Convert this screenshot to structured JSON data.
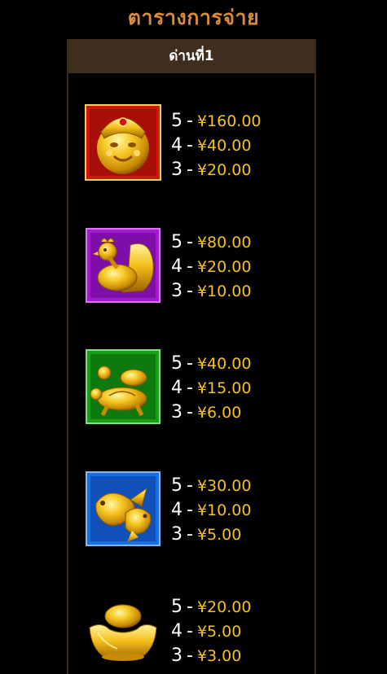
{
  "title": "ตารางการจ่าย",
  "level": "ด่านที่1",
  "colors": {
    "title": "#d98a3a",
    "header_bg": "#3f2d1e",
    "amount": "#f3c21d",
    "count": "#ffffff"
  },
  "symbols": [
    {
      "icon": "god-of-wealth-icon",
      "pays": [
        {
          "count": "5",
          "dash": "-",
          "amount": "¥160.00"
        },
        {
          "count": "4",
          "dash": "-",
          "amount": "¥40.00"
        },
        {
          "count": "3",
          "dash": "-",
          "amount": "¥20.00"
        }
      ]
    },
    {
      "icon": "rooster-icon",
      "pays": [
        {
          "count": "5",
          "dash": "-",
          "amount": "¥80.00"
        },
        {
          "count": "4",
          "dash": "-",
          "amount": "¥20.00"
        },
        {
          "count": "3",
          "dash": "-",
          "amount": "¥10.00"
        }
      ]
    },
    {
      "icon": "turtle-icon",
      "pays": [
        {
          "count": "5",
          "dash": "-",
          "amount": "¥40.00"
        },
        {
          "count": "4",
          "dash": "-",
          "amount": "¥15.00"
        },
        {
          "count": "3",
          "dash": "-",
          "amount": "¥6.00"
        }
      ]
    },
    {
      "icon": "koi-fish-icon",
      "pays": [
        {
          "count": "5",
          "dash": "-",
          "amount": "¥30.00"
        },
        {
          "count": "4",
          "dash": "-",
          "amount": "¥10.00"
        },
        {
          "count": "3",
          "dash": "-",
          "amount": "¥5.00"
        }
      ]
    },
    {
      "icon": "gold-ingot-icon",
      "pays": [
        {
          "count": "5",
          "dash": "-",
          "amount": "¥20.00"
        },
        {
          "count": "4",
          "dash": "-",
          "amount": "¥5.00"
        },
        {
          "count": "3",
          "dash": "-",
          "amount": "¥3.00"
        }
      ]
    }
  ]
}
